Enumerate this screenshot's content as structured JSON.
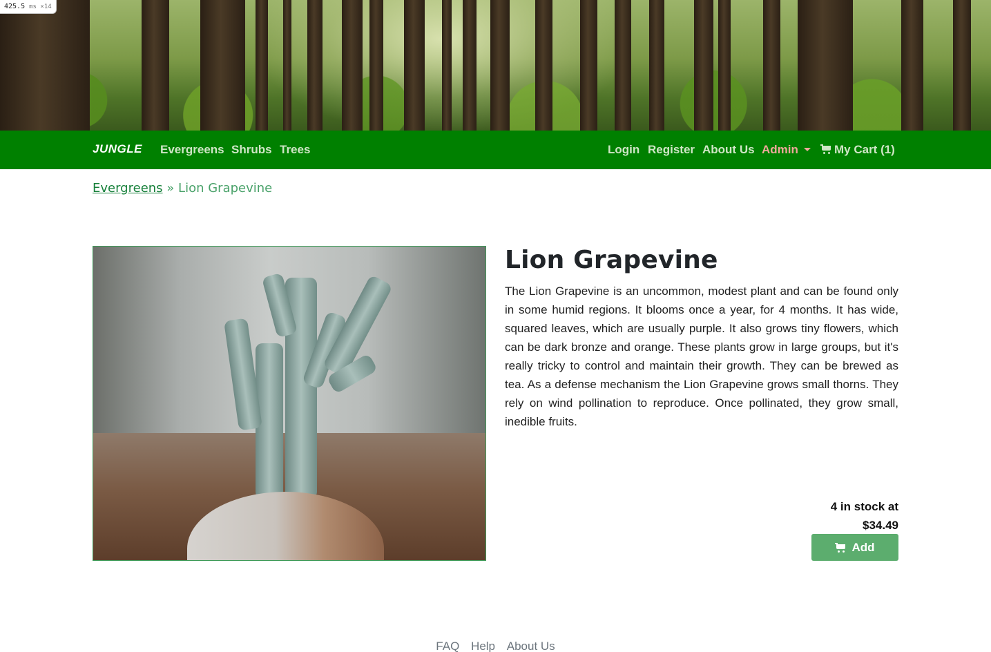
{
  "debug": {
    "timing_value": "425.5",
    "timing_unit": "ms ×14"
  },
  "navbar": {
    "brand": "JUNGLE",
    "left_links": [
      "Evergreens",
      "Shrubs",
      "Trees"
    ],
    "right_links": [
      "Login",
      "Register",
      "About Us"
    ],
    "admin_label": "Admin",
    "cart_label": "My Cart (1)"
  },
  "breadcrumb": {
    "parent": "Evergreens",
    "separator": "»",
    "current": "Lion Grapevine"
  },
  "product": {
    "title": "Lion Grapevine",
    "description": "The Lion Grapevine is an uncommon, modest plant and can be found only in some humid regions. It blooms once a year, for 4 months. It has wide, squared leaves, which are usually purple. It also grows tiny flowers, which can be dark bronze and orange. These plants grow in large groups, but it's really tricky to control and maintain their growth. They can be brewed as tea. As a defense mechanism the Lion Grapevine grows small thorns. They rely on wind pollination to reproduce. Once pollinated, they grow small, inedible fruits.",
    "stock_line1": "4 in stock at",
    "price": "$34.49",
    "add_label": "Add"
  },
  "footer": {
    "links": [
      "FAQ",
      "Help",
      "About Us"
    ]
  },
  "colors": {
    "nav_bg": "#008000",
    "nav_link": "#cfe6c6",
    "admin": "#f0a99b",
    "button": "#5cad6e"
  },
  "icons": {
    "cart": "shopping-cart-icon",
    "dropdown": "caret-down-icon"
  }
}
